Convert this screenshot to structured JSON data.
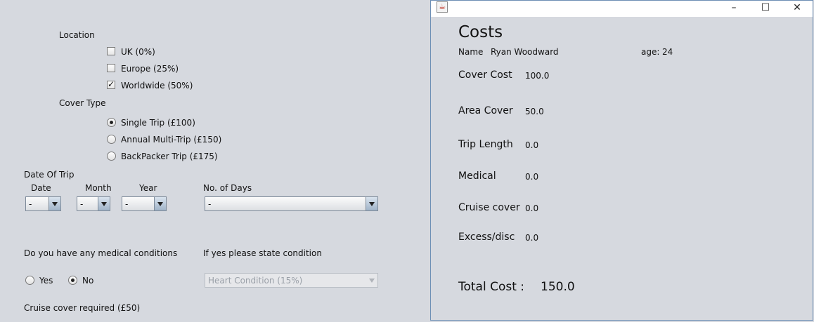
{
  "form": {
    "location_label": "Location",
    "location_options": [
      {
        "label": "UK (0%)",
        "checked": false
      },
      {
        "label": "Europe (25%)",
        "checked": false
      },
      {
        "label": "Worldwide (50%)",
        "checked": true
      }
    ],
    "cover_type_label": "Cover Type",
    "cover_options": [
      {
        "label": "Single Trip (£100)",
        "selected": true
      },
      {
        "label": "Annual Multi-Trip (£150)",
        "selected": false
      },
      {
        "label": "BackPacker Trip (£175)",
        "selected": false
      }
    ],
    "date_of_trip_label": "Date Of Trip",
    "date_label": "Date",
    "month_label": "Month",
    "year_label": "Year",
    "no_of_days_label": "No. of Days",
    "date_value": "-",
    "month_value": "-",
    "year_value": "-",
    "days_value": "-",
    "medical_question": "Do you have any medical conditions",
    "condition_prompt": "If yes please  state condition",
    "yes_label": "Yes",
    "no_label": "No",
    "medical_selected": "No",
    "condition_value": "Heart Condition (15%)",
    "cruise_label": "Cruise cover required (£50)"
  },
  "costs_window": {
    "title": "Costs",
    "name_label": "Name",
    "name_value": "Ryan Woodward",
    "age_label": "age:",
    "age_value": "24",
    "rows": [
      {
        "label": "Cover Cost",
        "value": "100.0"
      },
      {
        "label": "Area Cover",
        "value": "50.0"
      },
      {
        "label": "Trip Length",
        "value": "0.0"
      },
      {
        "label": "Medical",
        "value": "0.0"
      },
      {
        "label": "Cruise cover",
        "value": "0.0"
      },
      {
        "label": "Excess/disc",
        "value": "0.0"
      }
    ],
    "total_label": "Total Cost :",
    "total_value": "150.0",
    "window_controls": {
      "minimize": "–",
      "maximize": "☐",
      "close": "✕"
    },
    "app_icon": "java-coffee-icon"
  }
}
